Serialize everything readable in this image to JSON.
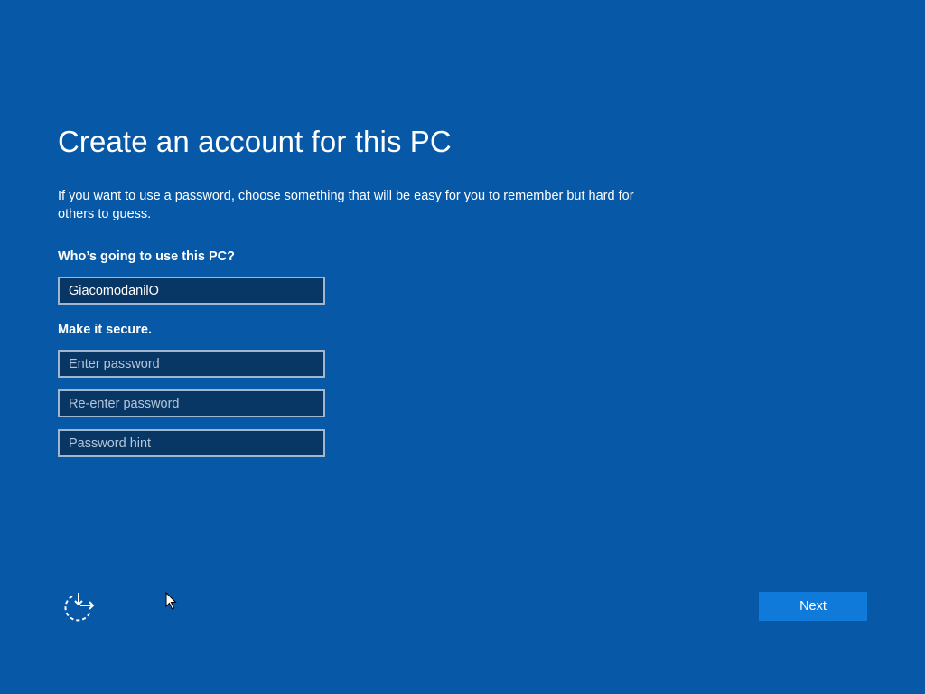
{
  "page": {
    "title": "Create an account for this PC",
    "description": "If you want to use a password, choose something that will be easy for you to remember but hard for others to guess."
  },
  "who_section": {
    "label": "Who’s going to use this PC?",
    "username_value": "GiacomodanilO"
  },
  "secure_section": {
    "label": "Make it secure.",
    "password_placeholder": "Enter password",
    "reenter_placeholder": "Re-enter password",
    "hint_placeholder": "Password hint"
  },
  "footer": {
    "ease_of_access_icon": "ease-of-access-icon",
    "next_label": "Next"
  },
  "colors": {
    "background": "#0759a8",
    "field_background": "#083766",
    "field_border": "#9fb8cf",
    "button_background": "#0f7ad9",
    "text": "#ffffff"
  }
}
